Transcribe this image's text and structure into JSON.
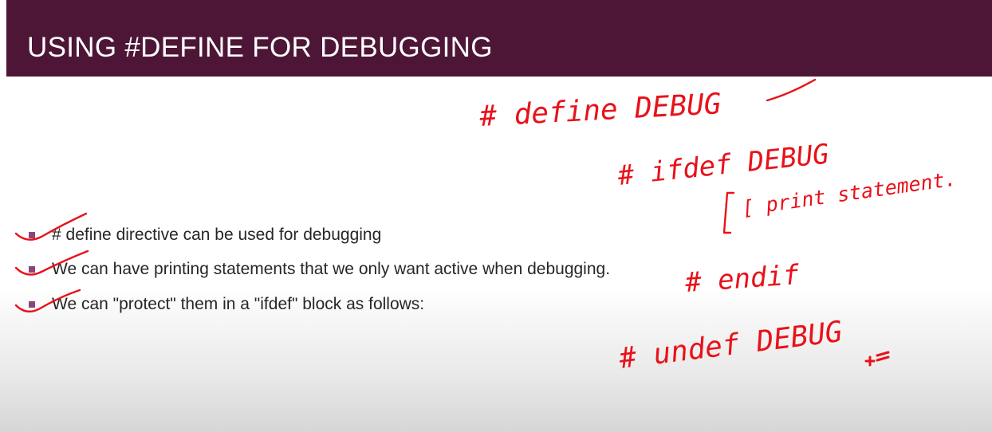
{
  "slide": {
    "title": "USING #DEFINE FOR DEBUGGING",
    "bullets": [
      {
        "text": "# define directive can be used for debugging"
      },
      {
        "text": "We can have printing statements that we only want active when debugging."
      },
      {
        "text": "We can \"protect\" them in a \"ifdef\" block as follows:"
      }
    ]
  },
  "annotations": {
    "color": "#e8121a",
    "line1": "# define DEBUG",
    "line2": "# ifdef DEBUG",
    "line3": "[ print statement.",
    "line4": "# endif",
    "line5": "# undef DEBUG"
  },
  "colors": {
    "title_bar": "#4e1636",
    "bullet_marker": "#8b4678",
    "ink": "#e8121a"
  }
}
